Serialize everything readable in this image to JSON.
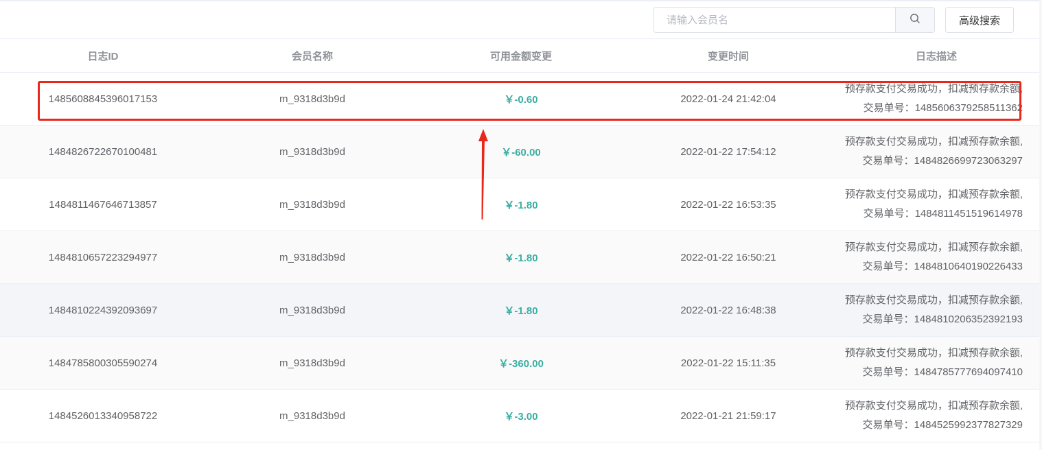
{
  "search": {
    "placeholder": "请输入会员名",
    "icon": "search-icon"
  },
  "toolbar": {
    "advanced_search_label": "高级搜索"
  },
  "table": {
    "columns": [
      "日志ID",
      "会员名称",
      "可用金额变更",
      "变更时间",
      "日志描述"
    ],
    "rows": [
      {
        "id": "1485608845396017153",
        "member": "m_9318d3b9d",
        "amount": "￥-0.60",
        "time": "2022-01-24 21:42:04",
        "desc_line1": "预存款支付交易成功，扣减预存款余额,",
        "desc_line2": "交易单号：1485606379258511362"
      },
      {
        "id": "1484826722670100481",
        "member": "m_9318d3b9d",
        "amount": "￥-60.00",
        "time": "2022-01-22 17:54:12",
        "desc_line1": "预存款支付交易成功，扣减预存款余额,",
        "desc_line2": "交易单号：1484826699723063297"
      },
      {
        "id": "1484811467646713857",
        "member": "m_9318d3b9d",
        "amount": "￥-1.80",
        "time": "2022-01-22 16:53:35",
        "desc_line1": "预存款支付交易成功，扣减预存款余额,",
        "desc_line2": "交易单号：1484811451519614978"
      },
      {
        "id": "1484810657223294977",
        "member": "m_9318d3b9d",
        "amount": "￥-1.80",
        "time": "2022-01-22 16:50:21",
        "desc_line1": "预存款支付交易成功，扣减预存款余额,",
        "desc_line2": "交易单号：1484810640190226433"
      },
      {
        "id": "1484810224392093697",
        "member": "m_9318d3b9d",
        "amount": "￥-1.80",
        "time": "2022-01-22 16:48:38",
        "desc_line1": "预存款支付交易成功，扣减预存款余额,",
        "desc_line2": "交易单号：1484810206352392193"
      },
      {
        "id": "1484785800305590274",
        "member": "m_9318d3b9d",
        "amount": "￥-360.00",
        "time": "2022-01-22 15:11:35",
        "desc_line1": "预存款支付交易成功，扣减预存款余额,",
        "desc_line2": "交易单号：1484785777694097410"
      },
      {
        "id": "1484526013340958722",
        "member": "m_9318d3b9d",
        "amount": "￥-3.00",
        "time": "2022-01-21 21:59:17",
        "desc_line1": "预存款支付交易成功，扣减预存款余额,",
        "desc_line2": "交易单号：1484525992377827329"
      }
    ]
  },
  "colors": {
    "amount": "#3aaea2",
    "annotation": "#e8281b",
    "header_text": "#909399",
    "body_text": "#606266"
  }
}
